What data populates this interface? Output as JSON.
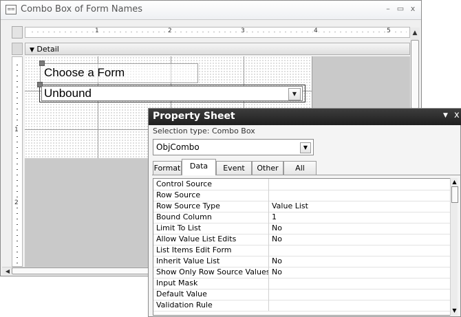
{
  "window": {
    "title": "Combo Box of Form Names",
    "icon": "form-icon",
    "minimize_glyph": "–",
    "restore_glyph": "▭",
    "close_glyph": "x"
  },
  "ruler": {
    "numbers": [
      "1",
      "2",
      "3",
      "4",
      "5"
    ],
    "vertical_numbers": [
      "1",
      "2"
    ]
  },
  "section": {
    "arrow": "▼",
    "label": "Detail"
  },
  "form": {
    "label_text": "Choose a Form",
    "combo_text": "Unbound",
    "combo_arrow": "▼"
  },
  "property_sheet": {
    "title": "Property Sheet",
    "pin_glyph": "▼",
    "close_glyph": "x",
    "selection_type": "Selection type:  Combo Box",
    "object_selector": "ObjCombo",
    "tabs": [
      "Format",
      "Data",
      "Event",
      "Other",
      "All"
    ],
    "active_tab": "Data",
    "rows": [
      {
        "name": "Control Source",
        "value": ""
      },
      {
        "name": "Row Source",
        "value": ""
      },
      {
        "name": "Row Source Type",
        "value": "Value List"
      },
      {
        "name": "Bound Column",
        "value": "1"
      },
      {
        "name": "Limit To List",
        "value": "No"
      },
      {
        "name": "Allow Value List Edits",
        "value": "No"
      },
      {
        "name": "List Items Edit Form",
        "value": ""
      },
      {
        "name": "Inherit Value List",
        "value": "No"
      },
      {
        "name": "Show Only Row Source Values",
        "value": "No"
      },
      {
        "name": "Input Mask",
        "value": ""
      },
      {
        "name": "Default Value",
        "value": ""
      },
      {
        "name": "Validation Rule",
        "value": ""
      }
    ]
  },
  "scroll": {
    "up": "▲",
    "down": "▼",
    "left": "◀"
  }
}
